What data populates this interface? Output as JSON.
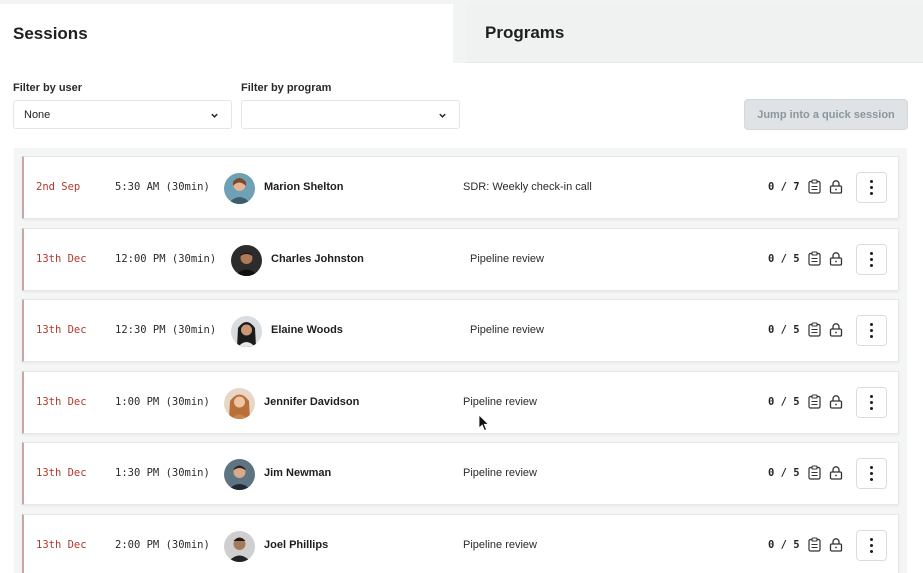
{
  "tabs": {
    "sessions": "Sessions",
    "programs": "Programs"
  },
  "filters": {
    "user_label": "Filter by user",
    "user_value": "None",
    "program_label": "Filter by program",
    "program_value": ""
  },
  "quick_session_label": "Jump into a quick session",
  "icons": {
    "dropdown": "chevron-down-icon",
    "notes": "clipboard-icon",
    "lock": "lock-icon",
    "menu": "more-vertical-icon",
    "pointer": "mouse-cursor-icon"
  },
  "colors": {
    "date": "#b03a2e",
    "row_accent": "#c9a7a7",
    "quick_button_bg": "#dfe3e6"
  },
  "sessions": [
    {
      "date": "2nd Sep",
      "time": "5:30 AM (30min)",
      "name": "Marion Shelton",
      "program": "SDR: Weekly check-in call",
      "count": "0 / 7"
    },
    {
      "date": "13th Dec",
      "time": "12:00 PM (30min)",
      "name": "Charles Johnston",
      "program": "Pipeline review",
      "count": "0 / 5"
    },
    {
      "date": "13th Dec",
      "time": "12:30 PM (30min)",
      "name": "Elaine Woods",
      "program": "Pipeline review",
      "count": "0 / 5"
    },
    {
      "date": "13th Dec",
      "time": "1:00 PM (30min)",
      "name": "Jennifer Davidson",
      "program": "Pipeline review",
      "count": "0 / 5"
    },
    {
      "date": "13th Dec",
      "time": "1:30 PM (30min)",
      "name": "Jim Newman",
      "program": "Pipeline review",
      "count": "0 / 5"
    },
    {
      "date": "13th Dec",
      "time": "2:00 PM (30min)",
      "name": "Joel Phillips",
      "program": "Pipeline review",
      "count": "0 / 5"
    }
  ]
}
